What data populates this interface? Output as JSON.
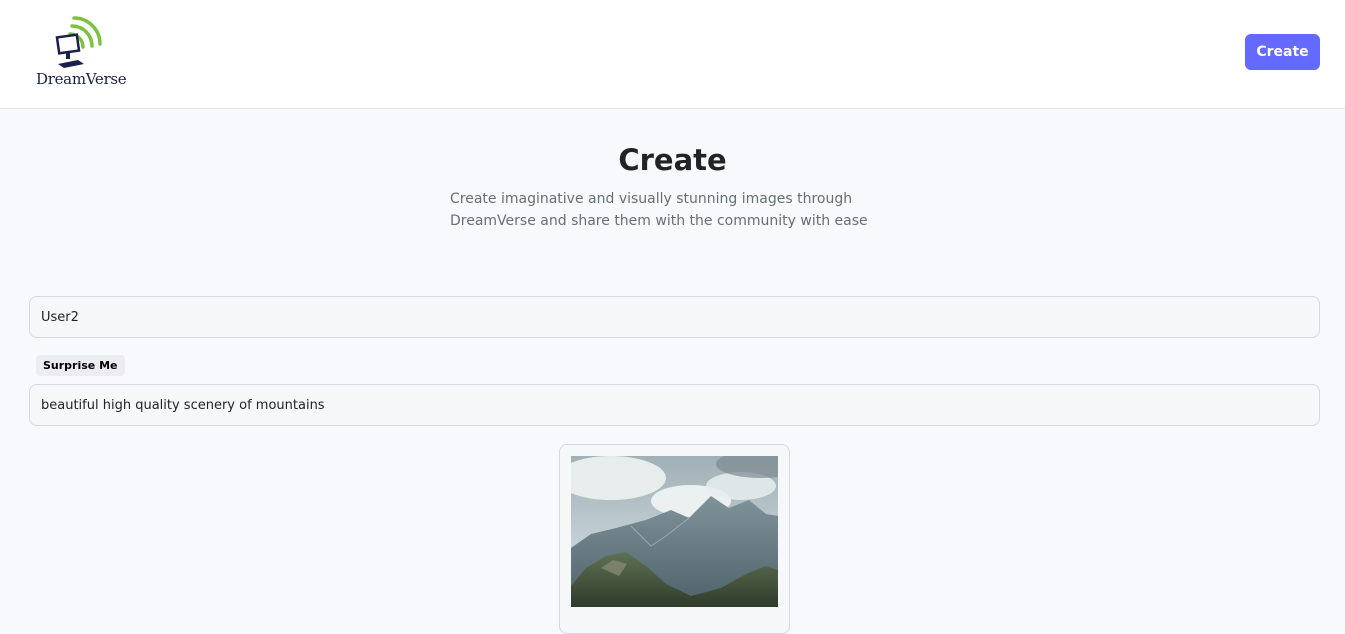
{
  "header": {
    "logo_text": "DreamVerse",
    "create_button": "Create"
  },
  "main": {
    "title": "Create",
    "subtitle": "Create imaginative and visually stunning images through DreamVerse and share them with the community with ease"
  },
  "form": {
    "name_value": "User2",
    "surprise_button": "Surprise Me",
    "prompt_value": "beautiful high quality scenery of mountains"
  },
  "colors": {
    "accent": "#6469ff",
    "logo_green": "#7cc242",
    "logo_navy": "#1b1f4b"
  }
}
